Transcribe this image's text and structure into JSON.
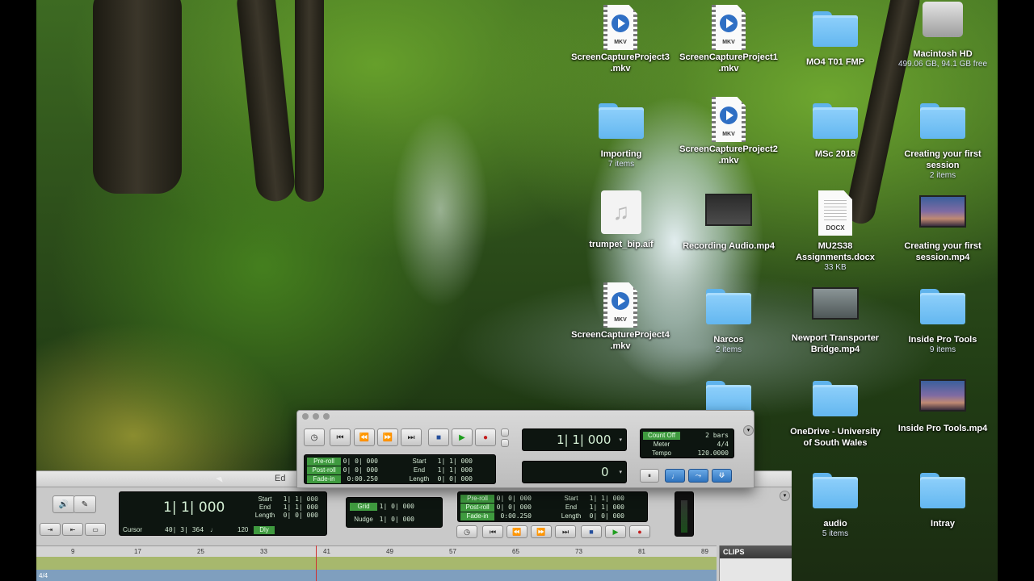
{
  "desktop_icons": [
    {
      "id": "scp3",
      "label": "ScreenCaptureProject3\n.mkv",
      "tag": "MKV"
    },
    {
      "id": "scp1",
      "label": "ScreenCaptureProject1\n.mkv",
      "tag": "MKV"
    },
    {
      "id": "mo4",
      "label": "MO4 T01 FMP"
    },
    {
      "id": "hd",
      "label": "Macintosh HD",
      "sub": "499.06 GB, 94.1 GB free"
    },
    {
      "id": "importing",
      "label": "Importing",
      "sub": "7 items"
    },
    {
      "id": "scp2",
      "label": "ScreenCaptureProject2\n.mkv",
      "tag": "MKV"
    },
    {
      "id": "msc",
      "label": "MSc 2018"
    },
    {
      "id": "cyfs",
      "label": "Creating your first\nsession",
      "sub": "2 items"
    },
    {
      "id": "trumpet",
      "label": "trumpet_bip.aif"
    },
    {
      "id": "recaudio",
      "label": "Recording Audio.mp4"
    },
    {
      "id": "mu2s38",
      "label": "MU2S38\nAssignments.docx",
      "sub": "33 KB",
      "tag": "DOCX"
    },
    {
      "id": "cyfs_mp4",
      "label": "Creating your first\nsession.mp4"
    },
    {
      "id": "scp4",
      "label": "ScreenCaptureProject4\n.mkv",
      "tag": "MKV"
    },
    {
      "id": "narcos",
      "label": "Narcos",
      "sub": "2 items"
    },
    {
      "id": "newport",
      "label": "Newport Transporter\nBridge.mp4"
    },
    {
      "id": "ipt",
      "label": "Inside Pro Tools",
      "sub": "9 items"
    },
    {
      "id": "onedrive",
      "label": "OneDrive - University\nof South Wales"
    },
    {
      "id": "ipt_mp4",
      "label": "Inside Pro Tools.mp4"
    },
    {
      "id": "audio",
      "label": "audio",
      "sub": "5 items"
    },
    {
      "id": "intray",
      "label": "Intray"
    }
  ],
  "transport": {
    "main_counter": "1| 1| 000",
    "sub_counter": "0",
    "preroll": {
      "label": "Pre-roll",
      "value": "0| 0| 000"
    },
    "postroll": {
      "label": "Post-roll",
      "value": "0| 0| 000"
    },
    "fadein": {
      "label": "Fade-in",
      "value": "0:00.250"
    },
    "start": {
      "label": "Start",
      "value": "1| 1| 000"
    },
    "end": {
      "label": "End",
      "value": "1| 1| 000"
    },
    "length": {
      "label": "Length",
      "value": "0| 0| 000"
    },
    "countoff": {
      "label": "Count Off",
      "value": "2 bars"
    },
    "meter": {
      "label": "Meter",
      "value": "4/4"
    },
    "tempo": {
      "label": "Tempo",
      "value": "120.0000"
    }
  },
  "edit_window": {
    "title": "Ed",
    "main_counter": "1| 1| 000",
    "start": {
      "label": "Start",
      "value": "1| 1| 000"
    },
    "end": {
      "label": "End",
      "value": "1| 1| 000"
    },
    "length": {
      "label": "Length",
      "value": "0| 0| 000"
    },
    "cursor": {
      "label": "Cursor",
      "value": "40| 3| 364"
    },
    "cursor_val2": "120",
    "dly_label": "Dly",
    "grid": {
      "label": "Grid",
      "value": "1| 0| 000"
    },
    "nudge": {
      "label": "Nudge",
      "value": "1| 0| 000"
    },
    "preroll": {
      "label": "Pre-roll",
      "value": "0| 0| 000"
    },
    "postroll": {
      "label": "Post-roll",
      "value": "0| 0| 000"
    },
    "fadein": {
      "label": "Fade-in",
      "value": "0:00.250"
    },
    "start2": {
      "label": "Start",
      "value": "1| 1| 000"
    },
    "end2": {
      "label": "End",
      "value": "1| 1| 000"
    },
    "length2": {
      "label": "Length",
      "value": "0| 0| 000"
    },
    "ruler_marks": [
      "9",
      "17",
      "25",
      "33",
      "41",
      "49",
      "57",
      "65",
      "73",
      "81",
      "89"
    ],
    "meter_track_label": "4/4",
    "clips_label": "CLIPS"
  }
}
